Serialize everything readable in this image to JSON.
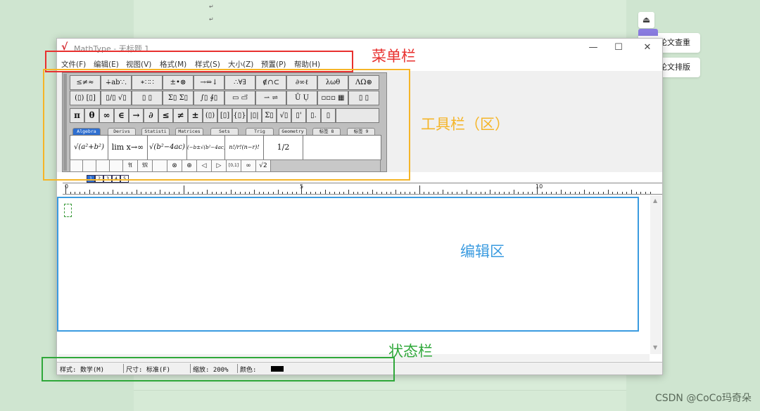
{
  "background": {
    "doc_return_mark": "↵"
  },
  "side_panel": {
    "up_icon": "⏏",
    "buttons": [
      {
        "label": "论文查重"
      },
      {
        "label": "论文排版"
      }
    ]
  },
  "window": {
    "title": "MathType - 无标题 1",
    "app_icon": "√",
    "controls": {
      "minimize": "—",
      "maximize": "☐",
      "close": "✕"
    },
    "menu": [
      "文件(F)",
      "编辑(E)",
      "视图(V)",
      "格式(M)",
      "样式(S)",
      "大小(Z)",
      "预置(P)",
      "帮助(H)"
    ],
    "toolbar": {
      "row1": [
        "≤≠≈",
        "∔ab∵.",
        "∗∷∷",
        "±•⊗",
        "→⇔↓",
        "∴∀∃",
        "∉∩⊂",
        "∂∞ℓ",
        "λωθ",
        "ΛΩ⊛"
      ],
      "row2": [
        "(▯) [▯]",
        "▯/▯ √▯",
        "▯ ▯",
        "Σ▯ Σ▯",
        "∫▯ ∮▯",
        "▭ ▭⃗",
        "⇀ ⇌",
        "Ū Ụ",
        "▫▫▫ ▦",
        "▯ ▯"
      ],
      "row3": [
        "π",
        "θ",
        "∞",
        "∈",
        "→",
        "∂",
        "≤",
        "≠",
        "±",
        "(▯)",
        "[▯]",
        "{▯}",
        "|▯|",
        "Σ▯",
        "√▯",
        "▯'",
        "▯.",
        "▯"
      ],
      "tabs": [
        "Algebra",
        "Derivs",
        "Statisti",
        "Matrices",
        "Sets",
        "Trig",
        "Geometry",
        "标签 8",
        "标签 9"
      ],
      "templates": [
        "√(a²+b²)",
        "lim x→∞",
        "√(b²−4ac)",
        "(−b±√(b²−4ac))/2a",
        "n!/r!(n−r)!",
        "1/2"
      ],
      "row5": [
        "",
        "",
        "",
        "",
        "𝔄",
        "𝔐",
        "",
        "⊗",
        "⊕",
        "◁",
        "▷",
        "[0,1]",
        "∞",
        "√2"
      ]
    },
    "subtabs": [
      "1",
      "2",
      "3",
      "4",
      "5"
    ],
    "ruler": {
      "labels": [
        "0",
        "5",
        "10"
      ]
    },
    "status": {
      "style": "样式: 数学(M)",
      "size": "尺寸: 标准(F)",
      "zoom": "缩放: 200%",
      "color": "颜色:"
    }
  },
  "annotations": {
    "menu": {
      "label": "菜单栏",
      "color": "#e8312f"
    },
    "toolbar": {
      "label": "工具栏（区）",
      "color": "#f5b528"
    },
    "editor": {
      "label": "编辑区",
      "color": "#3a9be0"
    },
    "status": {
      "label": "状态栏",
      "color": "#2fa83a"
    }
  },
  "watermark": "CSDN @CoCo玛奇朵"
}
